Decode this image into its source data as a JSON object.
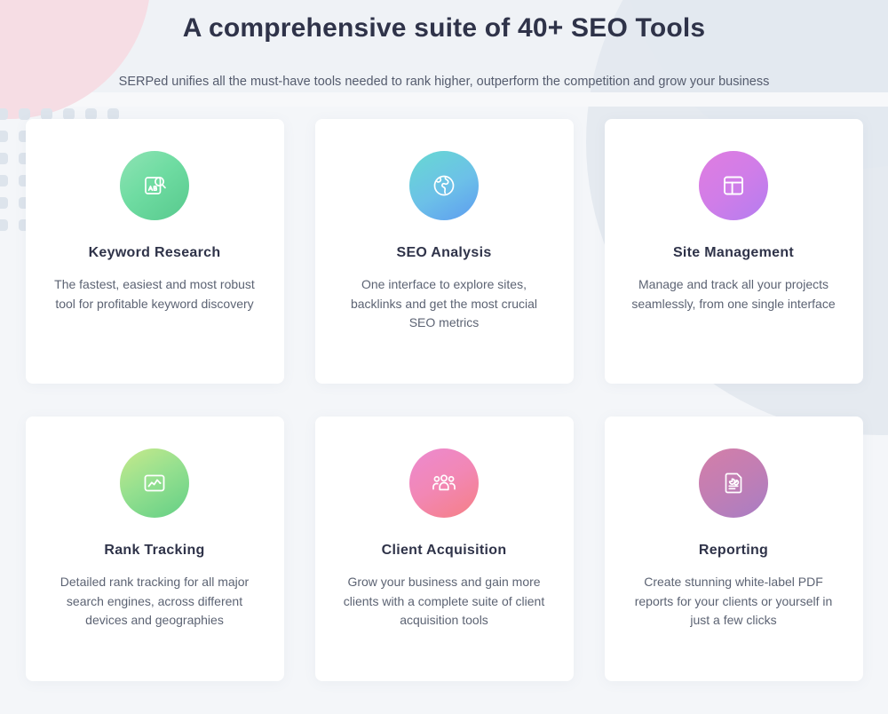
{
  "header": {
    "title": "A comprehensive suite of 40+ SEO Tools",
    "subtitle": "SERPed unifies all the must-have tools needed to rank higher, outperform the competition and grow your business"
  },
  "theme": {
    "page_background": "#f4f6f9",
    "card_background": "#ffffff",
    "heading_color": "#2f3349",
    "body_text_color": "#5c6373",
    "decor_pink": "#f6dde4",
    "decor_blue_gray": "#e2e7ee",
    "dot_color": "#dde4ec"
  },
  "features": [
    {
      "title": "Keyword Research",
      "description": "The fastest, easiest and most robust tool for profitable keyword discovery",
      "icon": "keyword-research-icon",
      "icon_gradient": [
        "#8fe3b4",
        "#57c98d"
      ]
    },
    {
      "title": "SEO Analysis",
      "description": "One interface to explore sites, backlinks and get the most crucial SEO metrics",
      "icon": "globe-analysis-icon",
      "icon_gradient": [
        "#67d9d2",
        "#5d9cf0"
      ]
    },
    {
      "title": "Site Management",
      "description": "Manage and track all your projects seamlessly, from one single interface",
      "icon": "layout-grid-icon",
      "icon_gradient": [
        "#e07de0",
        "#b47df0"
      ]
    },
    {
      "title": "Rank Tracking",
      "description": "Detailed rank tracking for all major search engines, across different devices and geographies",
      "icon": "line-chart-icon",
      "icon_gradient": [
        "#c8e98a",
        "#63cf85"
      ]
    },
    {
      "title": "Client Acquisition",
      "description": "Grow your business and gain more clients with a complete suite of client acquisition tools",
      "icon": "users-group-icon",
      "icon_gradient": [
        "#ec8ad0",
        "#f57f84"
      ]
    },
    {
      "title": "Reporting",
      "description": "Create stunning white-label PDF reports for your clients or yourself in just a few clicks",
      "icon": "report-document-icon",
      "icon_gradient": [
        "#d47fa8",
        "#a87dc4"
      ]
    }
  ]
}
